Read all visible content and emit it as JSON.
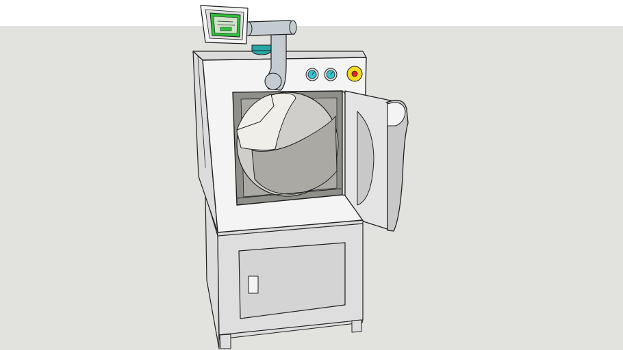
{
  "scene": {
    "subject": "sketchup-model",
    "colors": {
      "sky": "#ffffff",
      "ground": "#e2e2de",
      "cabinet_front": "#f4f4f4",
      "cabinet_side": "#dcdcdc",
      "base_front": "#dedede",
      "base_panel": "#d4d4d4",
      "chamber_dark": "#8f8f8a",
      "drum_light": "#efeee8",
      "drum_shadow": "#cfceca",
      "drum_inner": "#aaa9a3",
      "door": "#e4e4e4",
      "door_shade": "#c8c8c8",
      "duct": "#c4ccd2",
      "screen_green": "#2fbf3a",
      "screen_panel": "#cfe3c8",
      "gauge": "#34c3d1",
      "teal_collar": "#27a7a6",
      "button_yellow": "#f4dc1c",
      "button_red": "#e52424",
      "edge": "#1e1e1e"
    },
    "icons": [
      "gauge-icon",
      "gauge-icon",
      "emergency-stop-icon"
    ]
  }
}
